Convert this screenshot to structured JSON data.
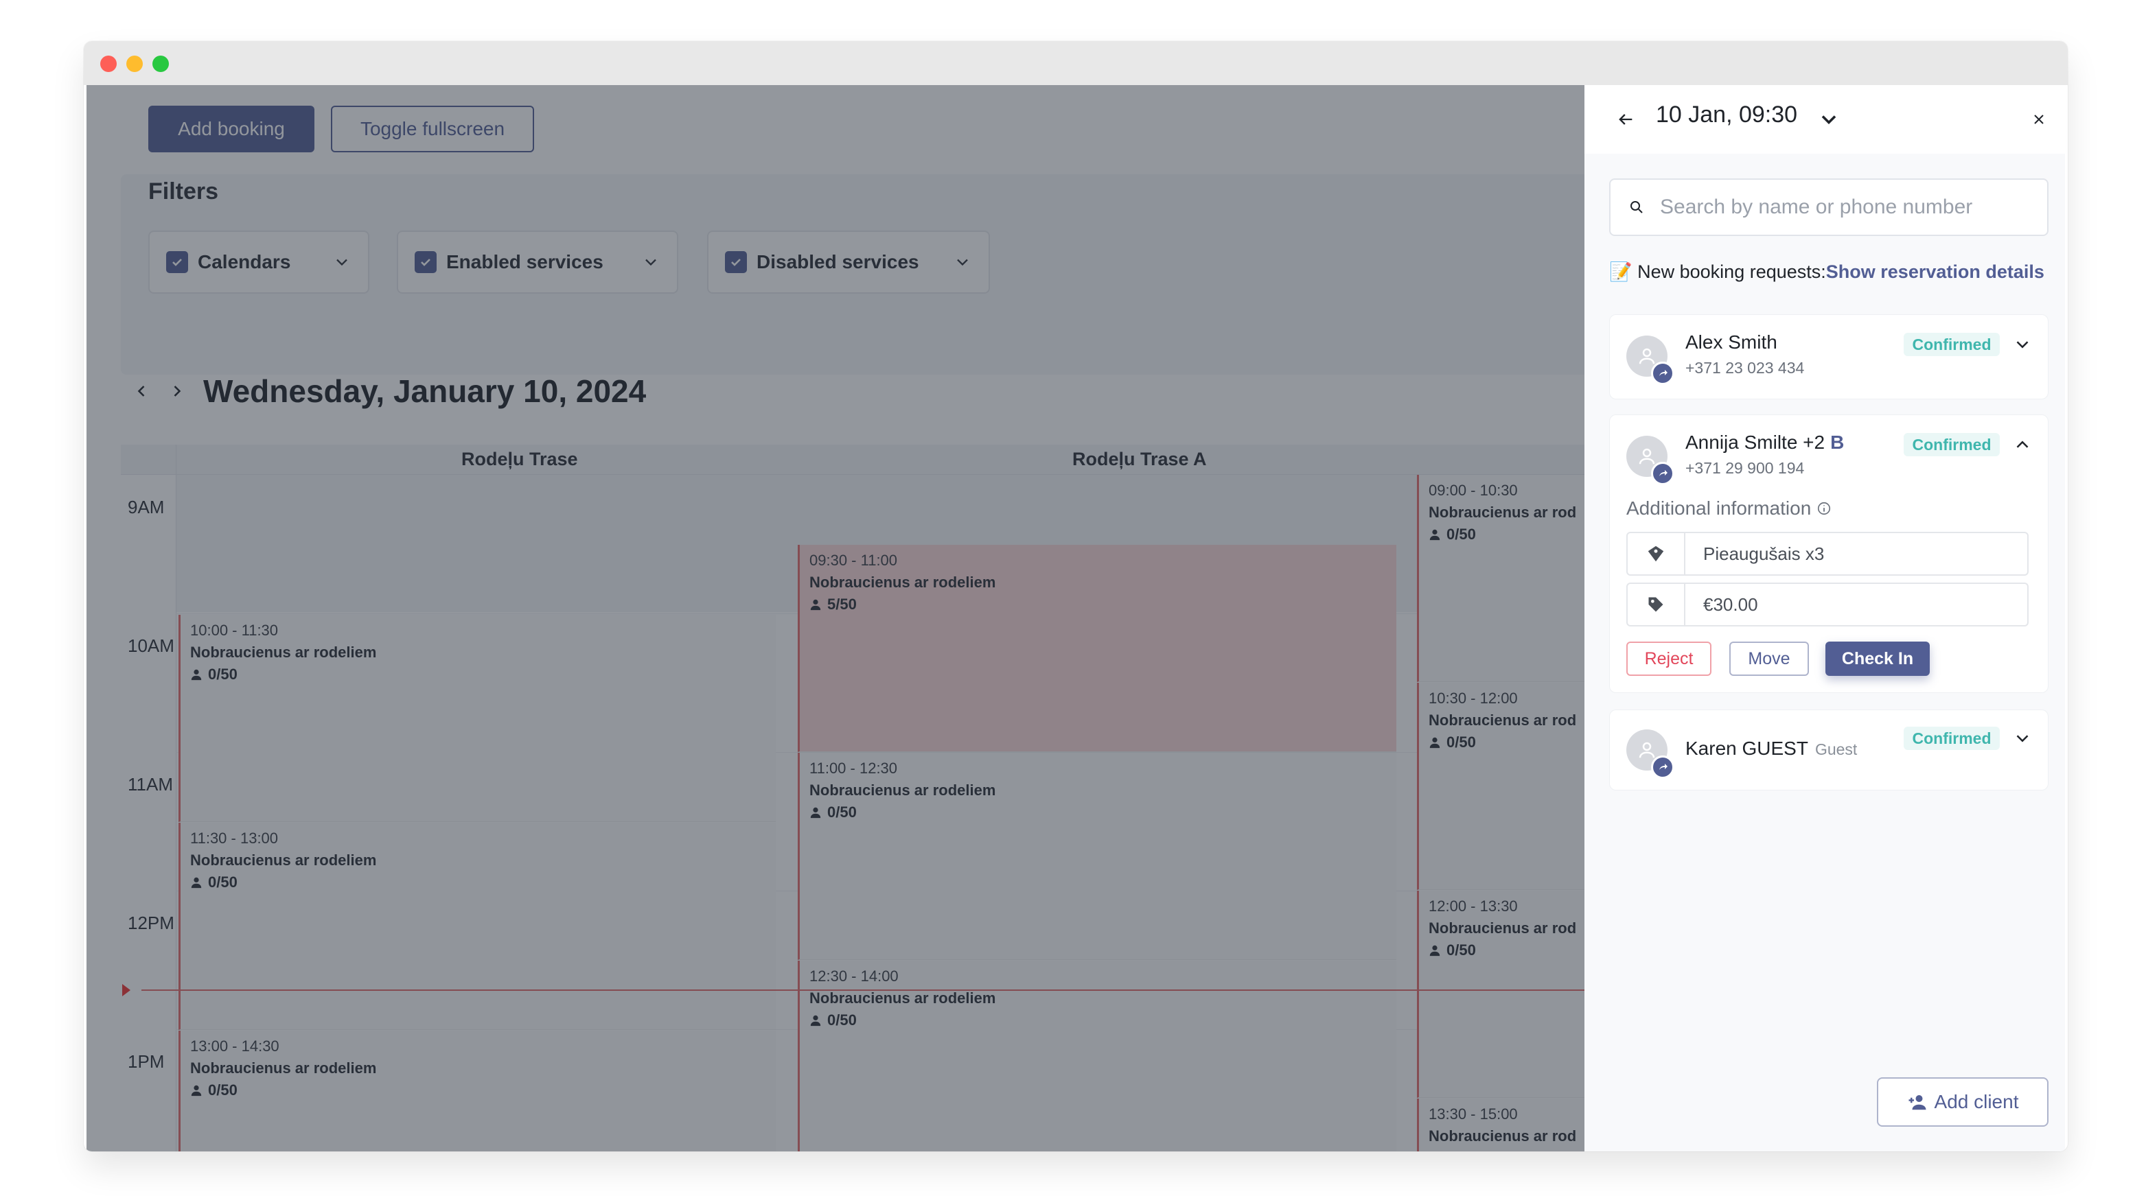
{
  "toolbar": {
    "add_booking": "Add booking",
    "toggle_fullscreen": "Toggle fullscreen"
  },
  "filters": {
    "title": "Filters",
    "items": [
      {
        "label": "Calendars",
        "checked": true
      },
      {
        "label": "Enabled services",
        "checked": true
      },
      {
        "label": "Disabled services",
        "checked": true
      }
    ]
  },
  "calendar": {
    "date_title": "Wednesday, January 10, 2024",
    "columns": [
      "Rodeļu Trase",
      "Rodeļu Trase A"
    ],
    "hours": [
      "9AM",
      "10AM",
      "11AM",
      "12PM",
      "1PM"
    ],
    "col1_slots": [
      {
        "time": "10:00 - 11:30",
        "name": "Nobraucienus ar rodeliem",
        "count": "0/50"
      },
      {
        "time": "11:30 - 13:00",
        "name": "Nobraucienus ar rodeliem",
        "count": "0/50"
      },
      {
        "time": "13:00 - 14:30",
        "name": "Nobraucienus ar rodeliem",
        "count": "0/50"
      }
    ],
    "col2_slots": [
      {
        "time": "09:30 - 11:00",
        "name": "Nobraucienus ar rodeliem",
        "count": "5/50"
      },
      {
        "time": "11:00 - 12:30",
        "name": "Nobraucienus ar rodeliem",
        "count": "0/50"
      },
      {
        "time": "12:30 - 14:00",
        "name": "Nobraucienus ar rodeliem",
        "count": "0/50"
      }
    ],
    "col3_slots": [
      {
        "time": "09:00 - 10:30",
        "name": "Nobraucienus ar rod",
        "count": "0/50"
      },
      {
        "time": "10:30 - 12:00",
        "name": "Nobraucienus ar rod",
        "count": "0/50"
      },
      {
        "time": "12:00 - 13:30",
        "name": "Nobraucienus ar rod",
        "count": "0/50"
      },
      {
        "time": "13:30 - 15:00",
        "name": "Nobraucienus ar rod",
        "count": ""
      }
    ]
  },
  "panel": {
    "date": "10 Jan, 09:30",
    "search_placeholder": "Search by name or phone number",
    "requests_label": "📝 New booking requests:",
    "requests_link": "Show reservation details",
    "clients": [
      {
        "name": "Alex Smith",
        "phone": "+371 23 023 434",
        "status": "Confirmed"
      },
      {
        "name": "Annija Smilte +2",
        "tag": "B",
        "phone": "+371 29 900 194",
        "status": "Confirmed"
      },
      {
        "name": "Karen GUEST",
        "guest": "Guest",
        "status": "Confirmed"
      }
    ],
    "additional_info_label": "Additional information",
    "info_ticket": "Pieaugušais x3",
    "info_price": "€30.00",
    "reject": "Reject",
    "move": "Move",
    "check_in": "Check In",
    "add_client": "Add client"
  },
  "colors": {
    "accent": "#525e94",
    "status_confirmed": "#3fb6ad",
    "danger": "#e2465a",
    "booked_slot": "#f8d7d7"
  }
}
